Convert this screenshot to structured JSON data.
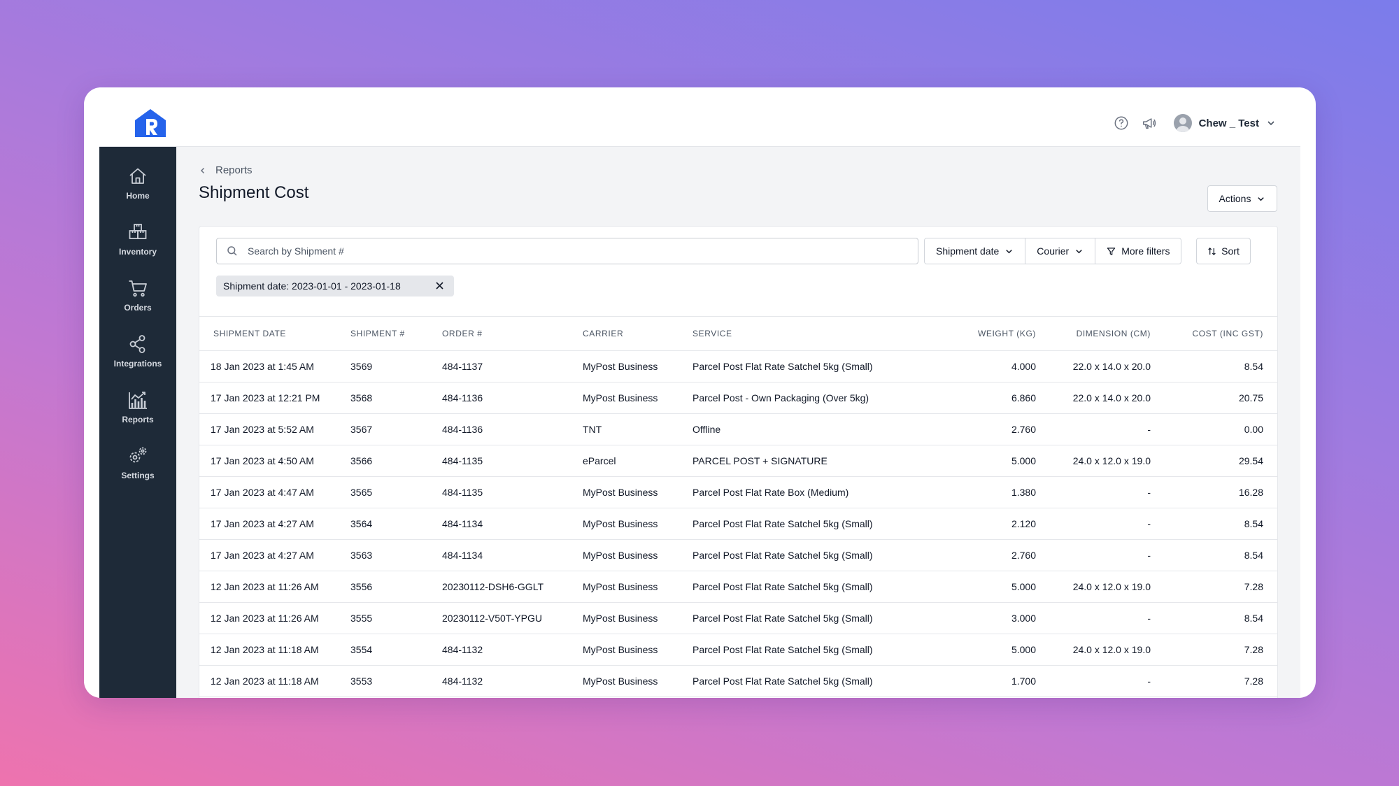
{
  "header": {
    "user_name": "Chew _ Test"
  },
  "sidebar": {
    "items": [
      {
        "label": "Home",
        "icon": "home-icon"
      },
      {
        "label": "Inventory",
        "icon": "inventory-icon"
      },
      {
        "label": "Orders",
        "icon": "cart-icon"
      },
      {
        "label": "Integrations",
        "icon": "share-icon"
      },
      {
        "label": "Reports",
        "icon": "reports-chart-icon"
      },
      {
        "label": "Settings",
        "icon": "gears-icon"
      }
    ]
  },
  "main": {
    "breadcrumb": "Reports",
    "title": "Shipment Cost",
    "actions_label": "Actions"
  },
  "toolbar": {
    "search_placeholder": "Search by Shipment #",
    "filters": {
      "shipment_date": "Shipment date",
      "courier": "Courier",
      "more_filters": "More filters"
    },
    "sort_label": "Sort",
    "active_filter_chip": "Shipment date: 2023-01-01 - 2023-01-18"
  },
  "table": {
    "columns": [
      "SHIPMENT DATE",
      "SHIPMENT #",
      "ORDER #",
      "CARRIER",
      "SERVICE",
      "WEIGHT (KG)",
      "DIMENSION (CM)",
      "COST (INC GST)"
    ],
    "rows": [
      [
        "18 Jan 2023 at 1:45 AM",
        "3569",
        "484-1137",
        "MyPost Business",
        "Parcel Post Flat Rate Satchel 5kg (Small)",
        "4.000",
        "22.0 x 14.0 x 20.0",
        "8.54"
      ],
      [
        "17 Jan 2023 at 12:21 PM",
        "3568",
        "484-1136",
        "MyPost Business",
        "Parcel Post - Own Packaging (Over 5kg)",
        "6.860",
        "22.0 x 14.0 x 20.0",
        "20.75"
      ],
      [
        "17 Jan 2023 at 5:52 AM",
        "3567",
        "484-1136",
        "TNT",
        "Offline",
        "2.760",
        "-",
        "0.00"
      ],
      [
        "17 Jan 2023 at 4:50 AM",
        "3566",
        "484-1135",
        "eParcel",
        "PARCEL POST + SIGNATURE",
        "5.000",
        "24.0 x 12.0 x 19.0",
        "29.54"
      ],
      [
        "17 Jan 2023 at 4:47 AM",
        "3565",
        "484-1135",
        "MyPost Business",
        "Parcel Post Flat Rate Box (Medium)",
        "1.380",
        "-",
        "16.28"
      ],
      [
        "17 Jan 2023 at 4:27 AM",
        "3564",
        "484-1134",
        "MyPost Business",
        "Parcel Post Flat Rate Satchel 5kg (Small)",
        "2.120",
        "-",
        "8.54"
      ],
      [
        "17 Jan 2023 at 4:27 AM",
        "3563",
        "484-1134",
        "MyPost Business",
        "Parcel Post Flat Rate Satchel 5kg (Small)",
        "2.760",
        "-",
        "8.54"
      ],
      [
        "12 Jan 2023 at 11:26 AM",
        "3556",
        "20230112-DSH6-GGLT",
        "MyPost Business",
        "Parcel Post Flat Rate Satchel 5kg (Small)",
        "5.000",
        "24.0 x 12.0 x 19.0",
        "7.28"
      ],
      [
        "12 Jan 2023 at 11:26 AM",
        "3555",
        "20230112-V50T-YPGU",
        "MyPost Business",
        "Parcel Post Flat Rate Satchel 5kg (Small)",
        "3.000",
        "-",
        "8.54"
      ],
      [
        "12 Jan 2023 at 11:18 AM",
        "3554",
        "484-1132",
        "MyPost Business",
        "Parcel Post Flat Rate Satchel 5kg (Small)",
        "5.000",
        "24.0 x 12.0 x 19.0",
        "7.28"
      ],
      [
        "12 Jan 2023 at 11:18 AM",
        "3553",
        "484-1132",
        "MyPost Business",
        "Parcel Post Flat Rate Satchel 5kg (Small)",
        "1.700",
        "-",
        "7.28"
      ]
    ]
  },
  "colors": {
    "brand": "#2563eb",
    "sidebar_bg": "#1e2a38",
    "page_bg": "#f3f4f6"
  }
}
